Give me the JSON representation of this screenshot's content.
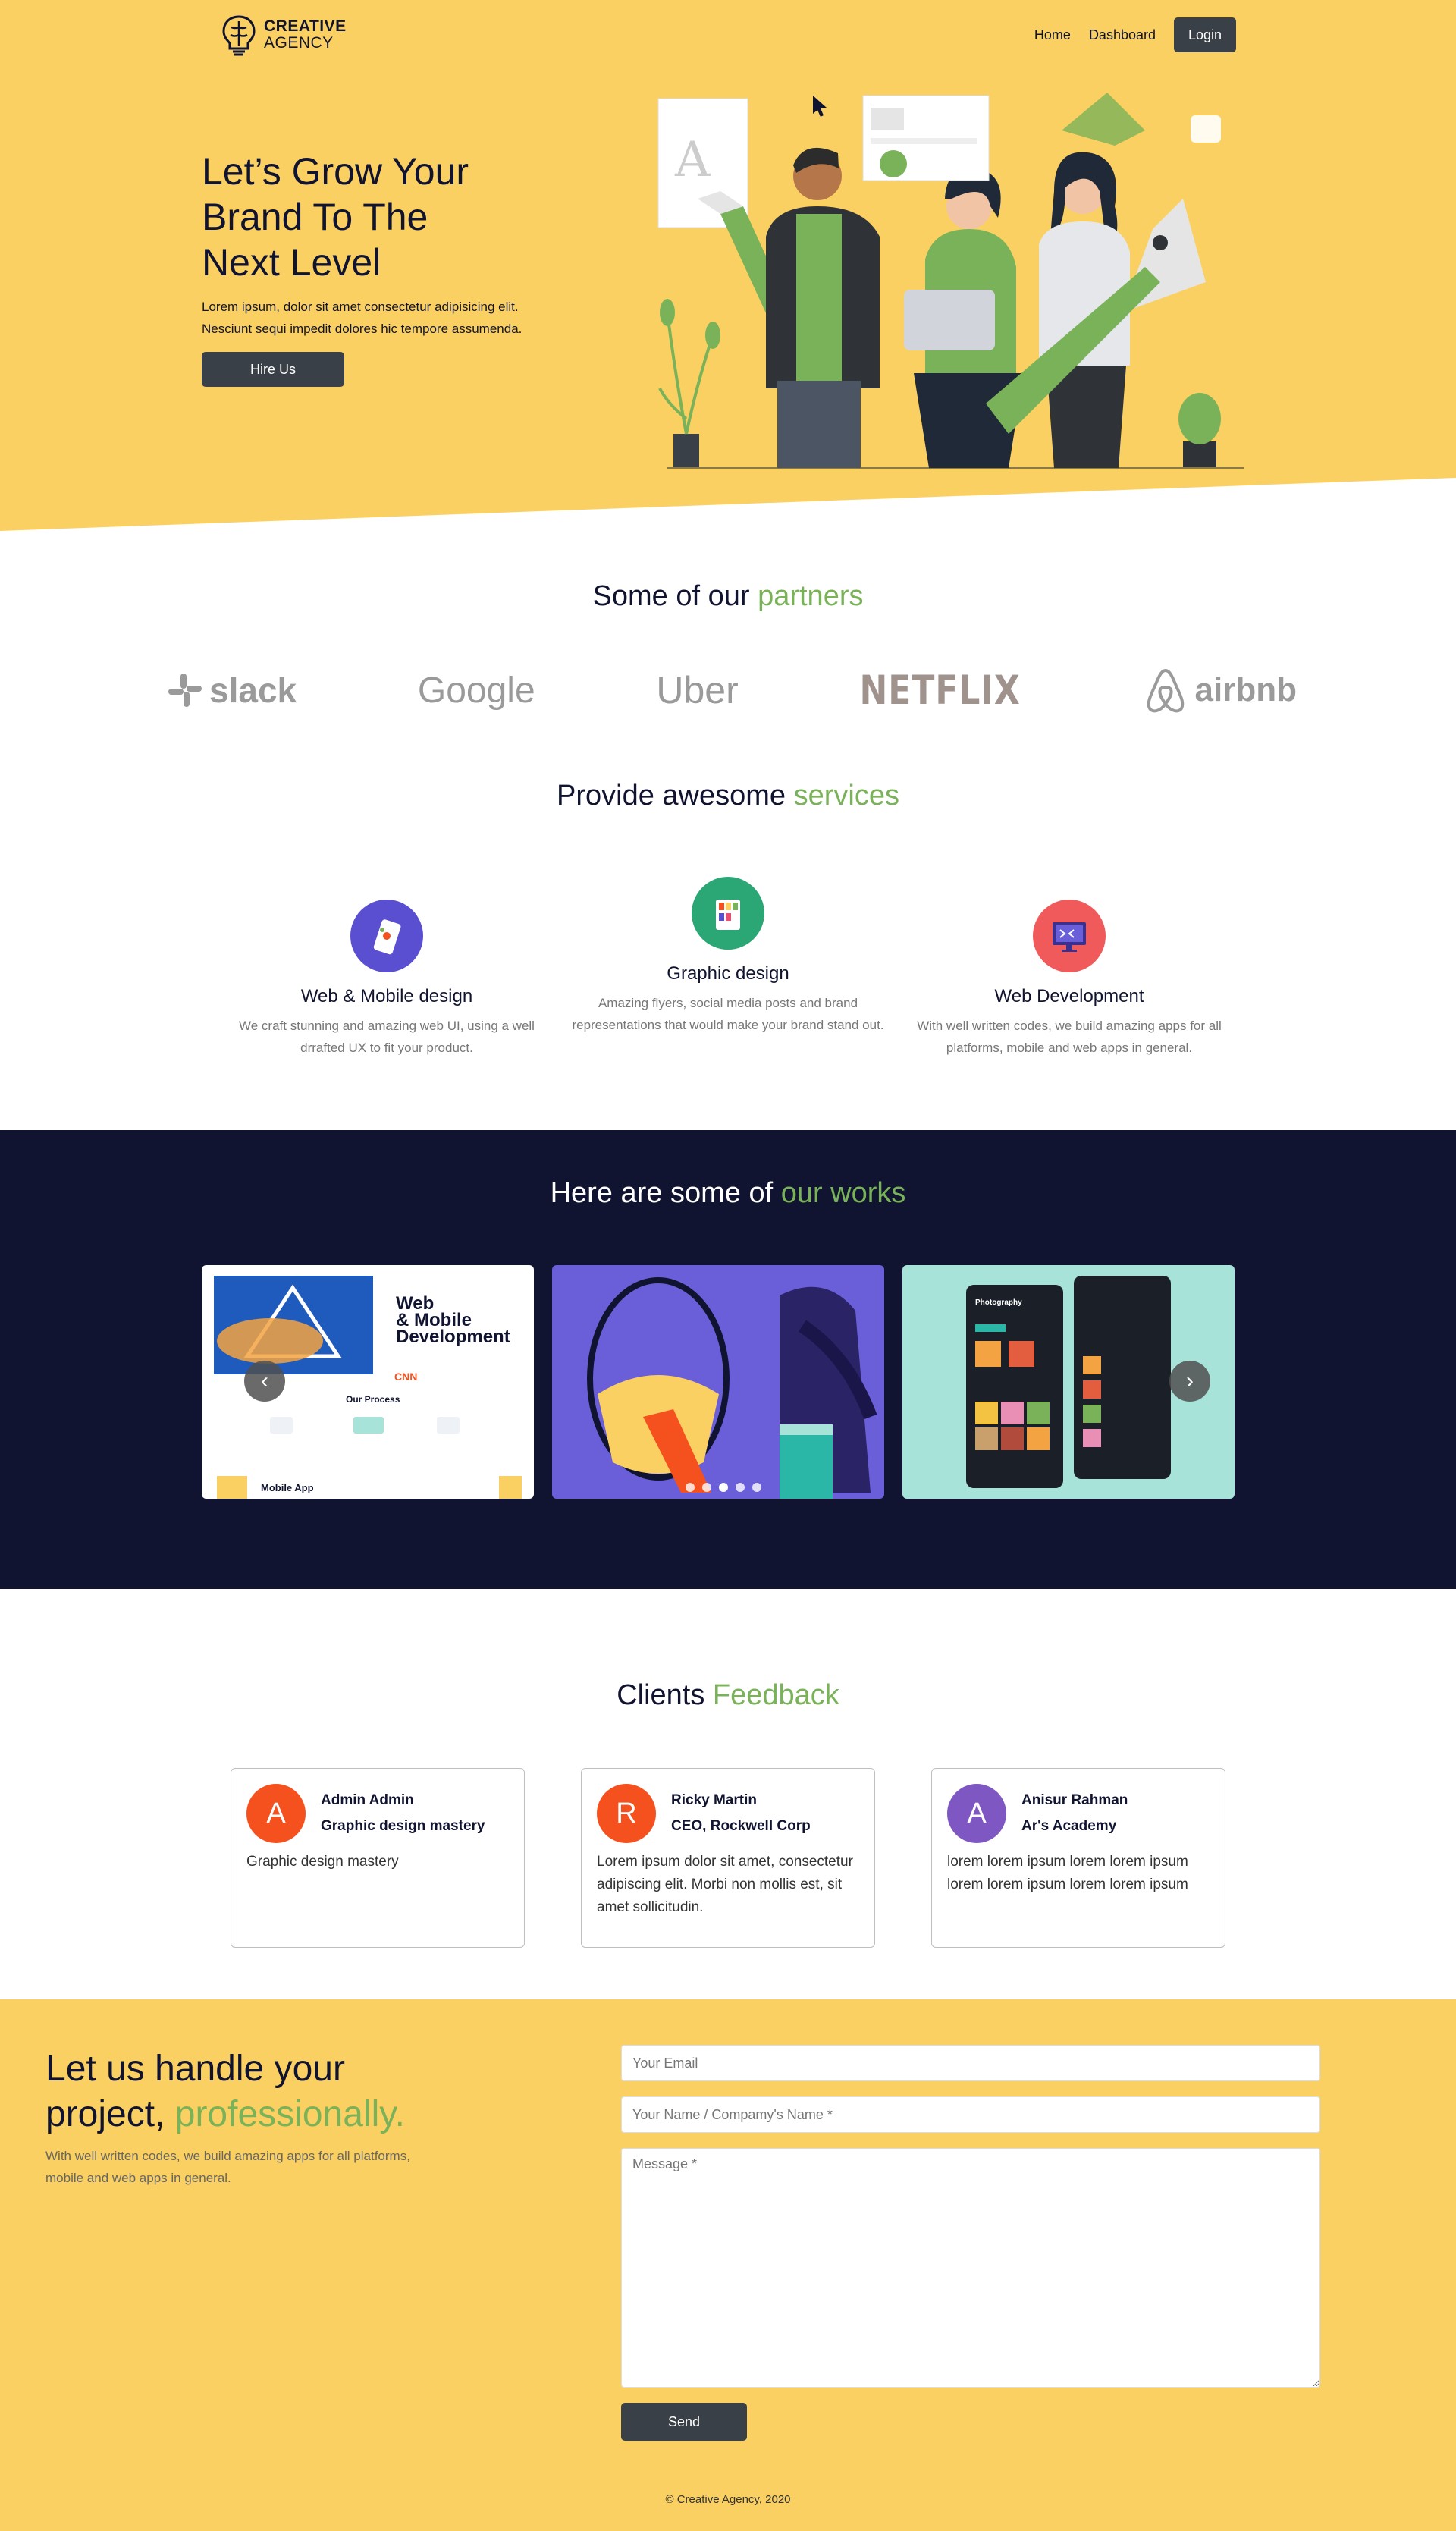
{
  "brand": {
    "line1": "CREATIVE",
    "line2": "AGENCY"
  },
  "nav": {
    "home": "Home",
    "dashboard": "Dashboard",
    "login": "Login"
  },
  "hero": {
    "title_1": "Let’s Grow Your",
    "title_2": "Brand To The",
    "title_3": "Next Level",
    "desc_1": "Lorem ipsum, dolor sit amet consectetur adipisicing elit.",
    "desc_2": "Nesciunt sequi impedit dolores hic tempore assumenda.",
    "cta": "Hire Us"
  },
  "partners": {
    "title_plain": "Some of our",
    "title_accent": "partners",
    "items": [
      "slack",
      "Google",
      "Uber",
      "NETFLIX",
      "airbnb"
    ]
  },
  "services": {
    "title_plain": "Provide awesome",
    "title_accent": "services",
    "items": [
      {
        "name": "Web & Mobile design",
        "desc": "We craft stunning and amazing web UI, using a well drrafted UX to fit your product.",
        "icon": "mobile-design-icon"
      },
      {
        "name": "Graphic design",
        "desc": "Amazing flyers, social media posts and brand representations that would make your brand stand out.",
        "icon": "color-palette-icon"
      },
      {
        "name": "Web Development",
        "desc": "With well written codes, we build amazing apps for all platforms, mobile and web apps in general.",
        "icon": "monitor-code-icon"
      }
    ]
  },
  "works": {
    "title_plain": "Here are some of",
    "title_accent": "our works",
    "slide1": {
      "heading_1": "Web",
      "heading_2": "& Mobile",
      "heading_3": "Development",
      "process": "Our Process",
      "bottom": "Mobile App"
    },
    "slide3": {
      "label": "Photography"
    }
  },
  "feedback": {
    "title_plain": "Clients",
    "title_accent": "Feedback",
    "items": [
      {
        "initial": "A",
        "name": "Admin Admin",
        "role": "Graphic design mastery",
        "text": "Graphic design mastery",
        "color": "#F4511E"
      },
      {
        "initial": "R",
        "name": "Ricky Martin",
        "role": "CEO, Rockwell Corp",
        "text": "Lorem ipsum dolor sit amet, consectetur adipiscing elit. Morbi non mollis est, sit amet sollicitudin.",
        "color": "#F4511E"
      },
      {
        "initial": "A",
        "name": "Anisur Rahman",
        "role": "Ar's Academy",
        "text": "lorem lorem ipsum lorem lorem ipsum lorem lorem ipsum lorem lorem ipsum",
        "color": "#7E57C2"
      }
    ]
  },
  "contact": {
    "title_1": "Let us handle your",
    "title_2": "project,",
    "title_accent": "professionally.",
    "desc_1": "With well written codes, we build amazing apps for all platforms,",
    "desc_2": "mobile and web apps in general.",
    "email_placeholder": "Your Email",
    "name_placeholder": "Your Name / Compamy's Name *",
    "message_placeholder": "Message *",
    "send": "Send"
  },
  "footer": {
    "text": "© Creative Agency, 2020"
  },
  "colors": {
    "yellow": "#FBD062",
    "navy": "#111430",
    "green": "#7AB259"
  }
}
